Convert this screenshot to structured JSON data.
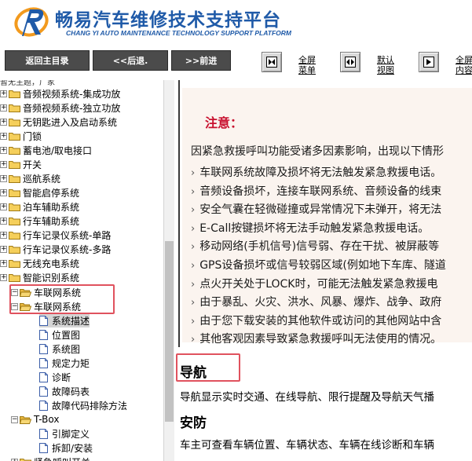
{
  "header": {
    "title": "畅易汽车维修技术支持平台",
    "subtitle": "CHANG YI AUTO MAINTENANCE TECHNOLOGY SUPPORT PLATFORM"
  },
  "toolbar": {
    "home_label": "返回主目录",
    "back_label": "<<后退.",
    "forward_label": ">>前进",
    "fullscreen_label_1": "全屏",
    "fullscreen_label_2": "菜单",
    "default_label_1": "默认",
    "default_label_2": "视图",
    "fullcontent_label_1": "全屏",
    "fullcontent_label_2": "内容"
  },
  "tree": {
    "top_partial": "暂无主题，厂家",
    "items": [
      {
        "label": "音频视频系统-集成功放"
      },
      {
        "label": "音频视频系统-独立功放"
      },
      {
        "label": "无钥匙进入及启动系统"
      },
      {
        "label": "门锁"
      },
      {
        "label": "蓄电池/取电接口"
      },
      {
        "label": "开关"
      },
      {
        "label": "巡航系统"
      },
      {
        "label": "智能启停系统"
      },
      {
        "label": "泊车辅助系统"
      },
      {
        "label": "行车辅助系统"
      },
      {
        "label": "行车记录仪系统-单路"
      },
      {
        "label": "行车记录仪系统-多路"
      },
      {
        "label": "无线充电系统"
      },
      {
        "label": "智能识别系统"
      }
    ],
    "open_root": "车联网系统",
    "open_child": "车联网系统",
    "docs": [
      {
        "label": "系统描述"
      },
      {
        "label": "位置图"
      },
      {
        "label": "系统图"
      },
      {
        "label": "规定力矩"
      },
      {
        "label": "诊断"
      },
      {
        "label": "故障码表"
      },
      {
        "label": "故障代码排除方法"
      }
    ],
    "tbox": "T-Box",
    "tbox_docs": [
      {
        "label": "引脚定义"
      },
      {
        "label": "拆卸/安装"
      }
    ],
    "bottom_partial": "紧急呼叫开关"
  },
  "content": {
    "notice_title": "注意：",
    "notice_intro": "因紧急救援呼叫功能受诸多因素影响，出现以下情形",
    "notice_items": [
      "车联网系统故障及损坏将无法触发紧急救援电话。",
      "音频设备损坏，连接车联网系统、音频设备的线束",
      "安全气囊在轻微碰撞或异常情况下未弹开，将无法",
      "E-Call按键损坏将无法手动触发紧急救援电话。",
      "移动网络(手机信号)信号弱、存在干扰、被屏蔽等",
      "GPS设备损坏或信号较弱区域(例如地下车库、隧道",
      "点火开关处于LOCK时，可能无法触发紧急救援电",
      "由于暴乱、火灾、洪水、风暴、爆炸、战争、政府",
      "由于您下载安装的其他软件或访问的其他网站中含",
      "其他客观因素导致紧急救援呼叫无法使用的情况。"
    ],
    "section1_title": "导航",
    "section1_text": "导航显示实时交通、在线导航、限行提醒及导航天气播",
    "section2_title": "安防",
    "section2_text": "车主可查看车辆位置、车辆状态、车辆在线诊断和车辆"
  },
  "colors": {
    "brand": "#1f5aa8",
    "highlight": "#e0525e",
    "notice_red": "#c8102e",
    "folder": "#f2c94c"
  }
}
